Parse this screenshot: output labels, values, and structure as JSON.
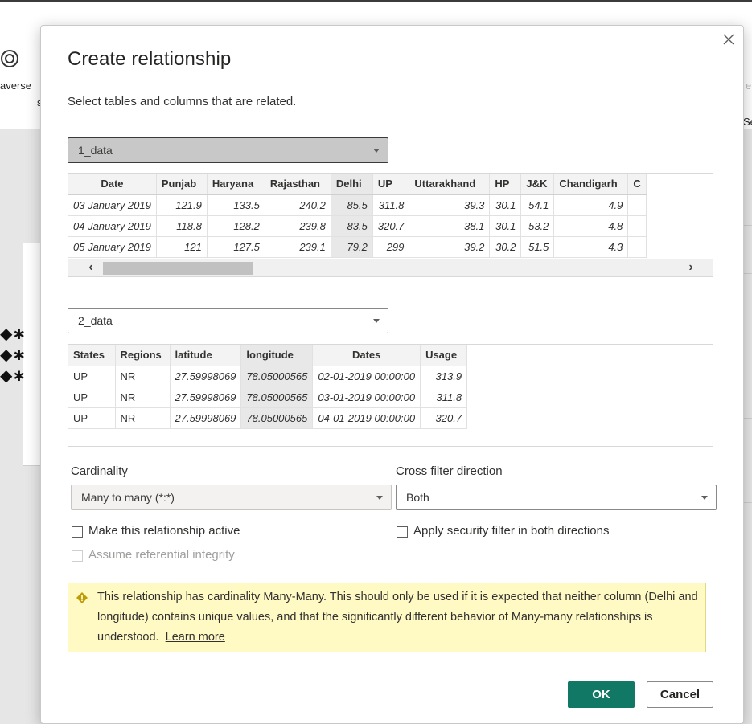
{
  "background": {
    "ribbon_label_1": "averse",
    "ribbon_label_2": "s",
    "right_frag_1": "er",
    "right_frag_2": "Se"
  },
  "dialog": {
    "title": "Create relationship",
    "subtitle": "Select tables and columns that are related.",
    "close_icon": "close-icon"
  },
  "table1": {
    "name": "1_data",
    "columns": [
      "Date",
      "Punjab",
      "Haryana",
      "Rajasthan",
      "Delhi",
      "UP",
      "Uttarakhand",
      "HP",
      "J&K",
      "Chandigarh",
      "C"
    ],
    "selected_column": "Delhi",
    "rows": [
      [
        "03 January 2019",
        "121.9",
        "133.5",
        "240.2",
        "85.5",
        "311.8",
        "39.3",
        "30.1",
        "54.1",
        "4.9",
        ""
      ],
      [
        "04 January 2019",
        "118.8",
        "128.2",
        "239.8",
        "83.5",
        "320.7",
        "38.1",
        "30.1",
        "53.2",
        "4.8",
        ""
      ],
      [
        "05 January 2019",
        "121",
        "127.5",
        "239.1",
        "79.2",
        "299",
        "39.2",
        "30.2",
        "51.5",
        "4.3",
        ""
      ]
    ]
  },
  "table2": {
    "name": "2_data",
    "columns": [
      "States",
      "Regions",
      "latitude",
      "longitude",
      "Dates",
      "Usage"
    ],
    "selected_column": "longitude",
    "rows": [
      [
        "UP",
        "NR",
        "27.59998069",
        "78.05000565",
        "02-01-2019 00:00:00",
        "313.9"
      ],
      [
        "UP",
        "NR",
        "27.59998069",
        "78.05000565",
        "03-01-2019 00:00:00",
        "311.8"
      ],
      [
        "UP",
        "NR",
        "27.59998069",
        "78.05000565",
        "04-01-2019 00:00:00",
        "320.7"
      ]
    ]
  },
  "cardinality": {
    "label": "Cardinality",
    "value": "Many to many (*:*)"
  },
  "cross_filter": {
    "label": "Cross filter direction",
    "value": "Both"
  },
  "options": {
    "make_active": "Make this relationship active",
    "apply_security": "Apply security filter in both directions",
    "assume_integrity": "Assume referential integrity"
  },
  "warning": {
    "text": "This relationship has cardinality Many-Many. This should only be used if it is expected that neither column (Delhi and longitude) contains unique values, and that the significantly different behavior of Many-many relationships is understood.",
    "link": "Learn more",
    "color": "#fff9c4"
  },
  "buttons": {
    "ok": "OK",
    "cancel": "Cancel",
    "ok_color": "#117865"
  }
}
